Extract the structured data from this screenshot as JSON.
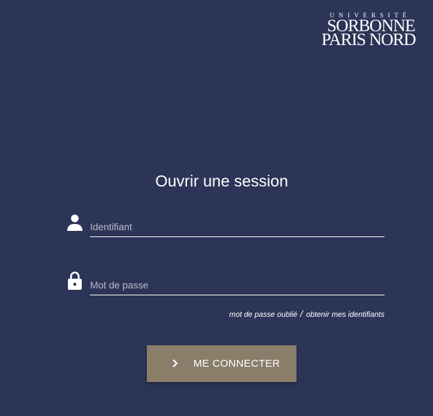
{
  "brand": {
    "line1": "UNIVERSITÉ",
    "line2": "SORBONNE",
    "line3": "PARIS NORD"
  },
  "login": {
    "title": "Ouvrir une session",
    "username": {
      "placeholder": "Identifiant",
      "value": "",
      "icon": "person-icon"
    },
    "password": {
      "placeholder": "Mot de passe",
      "value": "",
      "icon": "lock-icon"
    },
    "links": {
      "forgot_password": "mot de passe oublié",
      "separator": "/",
      "get_credentials": "obtenir mes identifiants"
    },
    "submit": {
      "label": "ME CONNECTER",
      "icon": "chevron-right-icon"
    }
  },
  "colors": {
    "background": "#2c3557",
    "button": "#8a7d6a",
    "text": "#ffffff",
    "placeholder": "#b8bccd"
  }
}
